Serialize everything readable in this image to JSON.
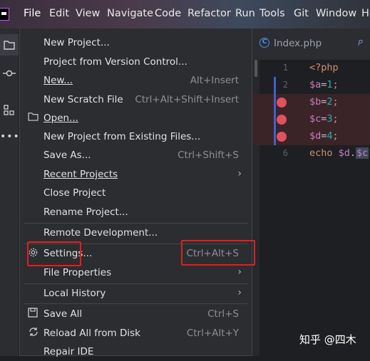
{
  "menubar": {
    "items": [
      "File",
      "Edit",
      "View",
      "Navigate",
      "Code",
      "Refactor",
      "Run",
      "Tools",
      "Git",
      "Window",
      "He"
    ]
  },
  "editor": {
    "tab_label": "Index.php",
    "tab_more": "P",
    "lines": [
      {
        "no": "1",
        "text": "<?php"
      },
      {
        "no": "2",
        "text": "$a=1;"
      },
      {
        "no": "3",
        "text": "$b=2;"
      },
      {
        "no": "4",
        "text": "$c=3;"
      },
      {
        "no": "5",
        "text": "$d=4;"
      },
      {
        "no": "6",
        "text": "echo $d.$c"
      }
    ]
  },
  "file_menu": {
    "items": [
      {
        "label": "New Project...",
        "shortcut": ""
      },
      {
        "label": "Project from Version Control...",
        "shortcut": ""
      },
      {
        "label": "New...",
        "shortcut": "Alt+Insert"
      },
      {
        "label": "New Scratch File",
        "shortcut": "Ctrl+Alt+Shift+Insert"
      },
      {
        "label": "Open...",
        "shortcut": ""
      },
      {
        "label": "New Project from Existing Files...",
        "shortcut": ""
      },
      {
        "label": "Save As...",
        "shortcut": "Ctrl+Shift+S"
      },
      {
        "label": "Recent Projects",
        "shortcut": ""
      },
      {
        "label": "Close Project",
        "shortcut": ""
      },
      {
        "label": "Rename Project...",
        "shortcut": ""
      },
      {
        "label": "Remote Development...",
        "shortcut": ""
      },
      {
        "label": "Settings...",
        "shortcut": "Ctrl+Alt+S"
      },
      {
        "label": "File Properties",
        "shortcut": ""
      },
      {
        "label": "Local History",
        "shortcut": ""
      },
      {
        "label": "Save All",
        "shortcut": "Ctrl+S"
      },
      {
        "label": "Reload All from Disk",
        "shortcut": "Ctrl+Alt+Y"
      },
      {
        "label": "Repair IDE",
        "shortcut": ""
      }
    ]
  },
  "watermark": "知乎 @四木",
  "colors": {
    "highlight_box": "#e02020",
    "breakpoint": "#e0525c",
    "accent": "#3e63c8"
  }
}
